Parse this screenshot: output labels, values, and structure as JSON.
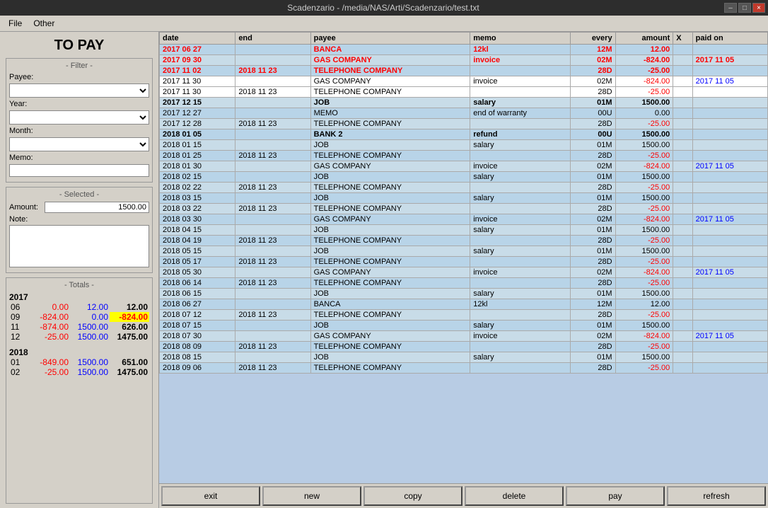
{
  "window": {
    "title": "Scadenzario - /media/NAS/Arti/Scadenzario/test.txt"
  },
  "titlebar_controls": [
    "–",
    "□",
    "×"
  ],
  "menu": {
    "items": [
      "File",
      "Other"
    ]
  },
  "left_panel": {
    "header": "TO PAY",
    "filter": {
      "title": "- Filter -",
      "payee_label": "Payee:",
      "year_label": "Year:",
      "month_label": "Month:",
      "memo_label": "Memo:"
    },
    "selected": {
      "title": "- Selected -",
      "amount_label": "Amount:",
      "amount_value": "1500.00",
      "note_label": "Note:"
    },
    "totals": {
      "title": "- Totals -",
      "year_2017": "2017",
      "year_2018": "2018",
      "rows_2017": [
        {
          "month": "06",
          "col1": "0.00",
          "col2": "12.00",
          "col3": "12.00",
          "col1_class": "color-red",
          "col2_class": "color-blue",
          "col3_class": "color-black"
        },
        {
          "month": "09",
          "col1": "-824.00",
          "col2": "0.00",
          "col3": "-824.00",
          "col1_class": "color-red",
          "col2_class": "color-blue",
          "col3_class": "color-yellow-bg"
        },
        {
          "month": "11",
          "col1": "-874.00",
          "col2": "1500.00",
          "col3": "626.00",
          "col1_class": "color-red",
          "col2_class": "color-blue",
          "col3_class": "color-black"
        },
        {
          "month": "12",
          "col1": "-25.00",
          "col2": "1500.00",
          "col3": "1475.00",
          "col1_class": "color-red",
          "col2_class": "color-blue",
          "col3_class": "color-black"
        }
      ],
      "rows_2018": [
        {
          "month": "01",
          "col1": "-849.00",
          "col2": "1500.00",
          "col3": "651.00",
          "col1_class": "color-red",
          "col2_class": "color-blue",
          "col3_class": "color-black"
        },
        {
          "month": "02",
          "col1": "-25.00",
          "col2": "1500.00",
          "col3": "1475.00",
          "col1_class": "color-red",
          "col2_class": "color-blue",
          "col3_class": "color-black"
        }
      ]
    }
  },
  "table": {
    "headers": [
      "date",
      "end",
      "payee",
      "memo",
      "every",
      "amount",
      "X",
      "paid on"
    ],
    "rows": [
      {
        "date": "2017 06 27",
        "end": "",
        "payee": "BANCA",
        "memo": "12kl",
        "every": "12M",
        "amount": "12.00",
        "x": "",
        "paid_on": "",
        "style": "red-bold"
      },
      {
        "date": "2017 09 30",
        "end": "",
        "payee": "GAS COMPANY",
        "memo": "invoice",
        "every": "02M",
        "amount": "-824.00",
        "x": "",
        "paid_on": "2017 11 05",
        "style": "red-bold"
      },
      {
        "date": "2017 11 02",
        "end": "2018 11 23",
        "payee": "TELEPHONE COMPANY",
        "memo": "",
        "every": "28D",
        "amount": "-25.00",
        "x": "",
        "paid_on": "",
        "style": "red-bold"
      },
      {
        "date": "2017 11 30",
        "end": "",
        "payee": "GAS COMPANY",
        "memo": "invoice",
        "every": "02M",
        "amount": "-824.00",
        "x": "",
        "paid_on": "2017 11 05",
        "style": "normal-white"
      },
      {
        "date": "2017 11 30",
        "end": "2018 11 23",
        "payee": "TELEPHONE COMPANY",
        "memo": "",
        "every": "28D",
        "amount": "-25.00",
        "x": "",
        "paid_on": "",
        "style": "normal-white"
      },
      {
        "date": "2017 12 15",
        "end": "",
        "payee": "JOB",
        "memo": "salary",
        "every": "01M",
        "amount": "1500.00",
        "x": "",
        "paid_on": "",
        "style": "bold"
      },
      {
        "date": "2017 12 27",
        "end": "",
        "payee": "MEMO",
        "memo": "end of warranty",
        "every": "00U",
        "amount": "0.00",
        "x": "",
        "paid_on": "",
        "style": "normal"
      },
      {
        "date": "2017 12 28",
        "end": "2018 11 23",
        "payee": "TELEPHONE COMPANY",
        "memo": "",
        "every": "28D",
        "amount": "-25.00",
        "x": "",
        "paid_on": "",
        "style": "normal"
      },
      {
        "date": "2018 01 05",
        "end": "",
        "payee": "BANK 2",
        "memo": "refund",
        "every": "00U",
        "amount": "1500.00",
        "x": "",
        "paid_on": "",
        "style": "bold"
      },
      {
        "date": "2018 01 15",
        "end": "",
        "payee": "JOB",
        "memo": "salary",
        "every": "01M",
        "amount": "1500.00",
        "x": "",
        "paid_on": "",
        "style": "normal"
      },
      {
        "date": "2018 01 25",
        "end": "2018 11 23",
        "payee": "TELEPHONE COMPANY",
        "memo": "",
        "every": "28D",
        "amount": "-25.00",
        "x": "",
        "paid_on": "",
        "style": "normal"
      },
      {
        "date": "2018 01 30",
        "end": "",
        "payee": "GAS COMPANY",
        "memo": "invoice",
        "every": "02M",
        "amount": "-824.00",
        "x": "",
        "paid_on": "2017 11 05",
        "style": "normal"
      },
      {
        "date": "2018 02 15",
        "end": "",
        "payee": "JOB",
        "memo": "salary",
        "every": "01M",
        "amount": "1500.00",
        "x": "",
        "paid_on": "",
        "style": "normal"
      },
      {
        "date": "2018 02 22",
        "end": "2018 11 23",
        "payee": "TELEPHONE COMPANY",
        "memo": "",
        "every": "28D",
        "amount": "-25.00",
        "x": "",
        "paid_on": "",
        "style": "normal"
      },
      {
        "date": "2018 03 15",
        "end": "",
        "payee": "JOB",
        "memo": "salary",
        "every": "01M",
        "amount": "1500.00",
        "x": "",
        "paid_on": "",
        "style": "normal"
      },
      {
        "date": "2018 03 22",
        "end": "2018 11 23",
        "payee": "TELEPHONE COMPANY",
        "memo": "",
        "every": "28D",
        "amount": "-25.00",
        "x": "",
        "paid_on": "",
        "style": "normal"
      },
      {
        "date": "2018 03 30",
        "end": "",
        "payee": "GAS COMPANY",
        "memo": "invoice",
        "every": "02M",
        "amount": "-824.00",
        "x": "",
        "paid_on": "2017 11 05",
        "style": "normal"
      },
      {
        "date": "2018 04 15",
        "end": "",
        "payee": "JOB",
        "memo": "salary",
        "every": "01M",
        "amount": "1500.00",
        "x": "",
        "paid_on": "",
        "style": "normal"
      },
      {
        "date": "2018 04 19",
        "end": "2018 11 23",
        "payee": "TELEPHONE COMPANY",
        "memo": "",
        "every": "28D",
        "amount": "-25.00",
        "x": "",
        "paid_on": "",
        "style": "normal"
      },
      {
        "date": "2018 05 15",
        "end": "",
        "payee": "JOB",
        "memo": "salary",
        "every": "01M",
        "amount": "1500.00",
        "x": "",
        "paid_on": "",
        "style": "normal"
      },
      {
        "date": "2018 05 17",
        "end": "2018 11 23",
        "payee": "TELEPHONE COMPANY",
        "memo": "",
        "every": "28D",
        "amount": "-25.00",
        "x": "",
        "paid_on": "",
        "style": "normal"
      },
      {
        "date": "2018 05 30",
        "end": "",
        "payee": "GAS COMPANY",
        "memo": "invoice",
        "every": "02M",
        "amount": "-824.00",
        "x": "",
        "paid_on": "2017 11 05",
        "style": "normal"
      },
      {
        "date": "2018 06 14",
        "end": "2018 11 23",
        "payee": "TELEPHONE COMPANY",
        "memo": "",
        "every": "28D",
        "amount": "-25.00",
        "x": "",
        "paid_on": "",
        "style": "normal"
      },
      {
        "date": "2018 06 15",
        "end": "",
        "payee": "JOB",
        "memo": "salary",
        "every": "01M",
        "amount": "1500.00",
        "x": "",
        "paid_on": "",
        "style": "normal"
      },
      {
        "date": "2018 06 27",
        "end": "",
        "payee": "BANCA",
        "memo": "12kl",
        "every": "12M",
        "amount": "12.00",
        "x": "",
        "paid_on": "",
        "style": "normal"
      },
      {
        "date": "2018 07 12",
        "end": "2018 11 23",
        "payee": "TELEPHONE COMPANY",
        "memo": "",
        "every": "28D",
        "amount": "-25.00",
        "x": "",
        "paid_on": "",
        "style": "normal"
      },
      {
        "date": "2018 07 15",
        "end": "",
        "payee": "JOB",
        "memo": "salary",
        "every": "01M",
        "amount": "1500.00",
        "x": "",
        "paid_on": "",
        "style": "normal"
      },
      {
        "date": "2018 07 30",
        "end": "",
        "payee": "GAS COMPANY",
        "memo": "invoice",
        "every": "02M",
        "amount": "-824.00",
        "x": "",
        "paid_on": "2017 11 05",
        "style": "normal"
      },
      {
        "date": "2018 08 09",
        "end": "2018 11 23",
        "payee": "TELEPHONE COMPANY",
        "memo": "",
        "every": "28D",
        "amount": "-25.00",
        "x": "",
        "paid_on": "",
        "style": "normal"
      },
      {
        "date": "2018 08 15",
        "end": "",
        "payee": "JOB",
        "memo": "salary",
        "every": "01M",
        "amount": "1500.00",
        "x": "",
        "paid_on": "",
        "style": "normal"
      },
      {
        "date": "2018 09 06",
        "end": "2018 11 23",
        "payee": "TELEPHONE COMPANY",
        "memo": "",
        "every": "28D",
        "amount": "-25.00",
        "x": "",
        "paid_on": "",
        "style": "normal"
      }
    ]
  },
  "buttons": {
    "exit": "exit",
    "new": "new",
    "copy": "copy",
    "delete": "delete",
    "pay": "pay",
    "refresh": "refresh"
  }
}
